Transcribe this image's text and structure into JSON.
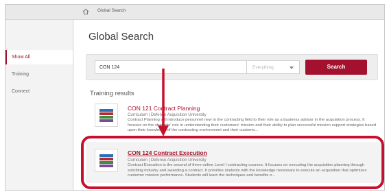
{
  "breadcrumb": {
    "home_icon": "home-icon",
    "label": "Global Search"
  },
  "sidebar": {
    "items": [
      {
        "label": "Show All",
        "active": true
      },
      {
        "label": "Training",
        "active": false
      },
      {
        "label": "Connect",
        "active": false
      }
    ]
  },
  "page": {
    "title": "Global Search"
  },
  "search": {
    "value": "CON 124",
    "scope": "Everything",
    "button_label": "Search"
  },
  "results": {
    "heading": "Training results",
    "items": [
      {
        "title": "CON 121 Contract Planning",
        "meta": "Curriculum  |  Defense Acquisition University",
        "description": "Contract Planning will introduce personnel new to the contracting field to their role as a business advisor in the acquisition process. It focuses on the students' role in understanding their customers' mission and their ability to plan successful mission support strategies based upon their knowledge of the contracting environment and their custome..."
      },
      {
        "title": "CON 124 Contract Execution",
        "meta": "Curriculum  |  Defense Acquisition University",
        "description": "Contract Execution is the second of three online Level I contracting courses. It focuses on executing the acquisition planning through soliciting industry and awarding a contract. It provides students with the knowledge necessary to execute an acquisition that optimizes customer mission performance. Students will learn the techniques and benefits o..."
      }
    ]
  },
  "colors": {
    "accent": "#a4112e",
    "annotation": "#c8102e"
  }
}
